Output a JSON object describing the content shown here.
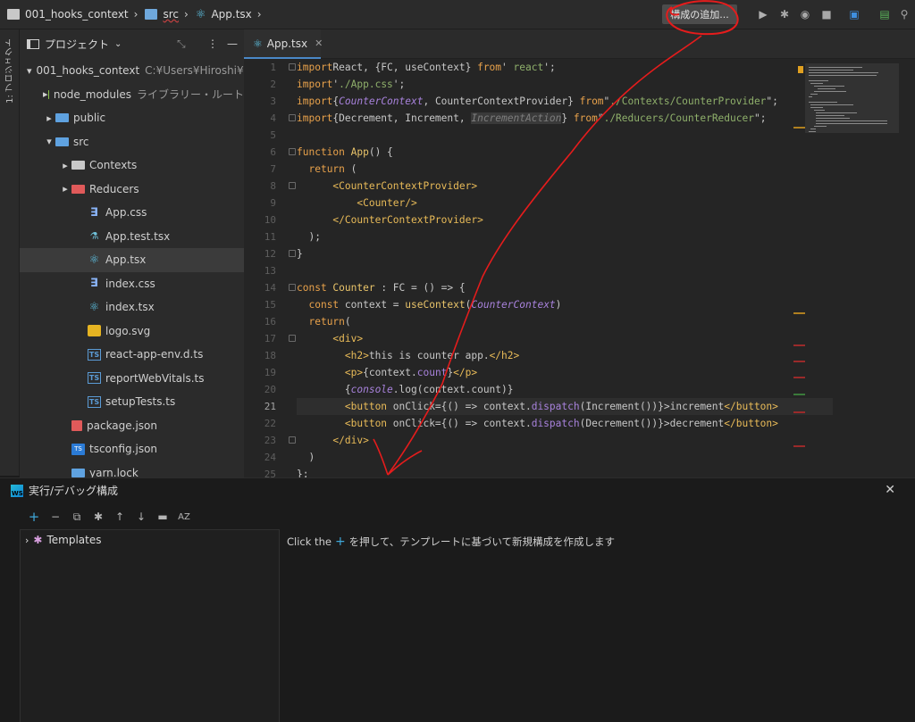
{
  "navbar": {
    "crumbs": [
      "001_hooks_context",
      "src",
      "App.tsx"
    ],
    "add_config_label": "構成の追加..."
  },
  "toolstrip": {
    "project_label": "1: プロジェクト"
  },
  "project": {
    "title": "プロジェクト",
    "tree": [
      {
        "label": "001_hooks_context",
        "hint": "C:¥Users¥Hiroshi¥Desk",
        "icon": "folder-icon",
        "arrow": "▾"
      },
      {
        "label": "node_modules",
        "hint": "ライブラリー・ルート",
        "icon": "folder-library-icon",
        "arrow": "▸"
      },
      {
        "label": "public",
        "hint": "",
        "icon": "folder-public-icon",
        "arrow": "▸"
      },
      {
        "label": "src",
        "hint": "",
        "icon": "folder-source-icon",
        "arrow": "▾"
      },
      {
        "label": "Contexts",
        "hint": "",
        "icon": "folder-icon",
        "arrow": "▸"
      },
      {
        "label": "Reducers",
        "hint": "",
        "icon": "folder-red-icon",
        "arrow": "▸"
      },
      {
        "label": "App.css",
        "hint": "",
        "icon": "css-file-icon",
        "arrow": ""
      },
      {
        "label": "App.test.tsx",
        "hint": "",
        "icon": "test-file-icon",
        "arrow": ""
      },
      {
        "label": "App.tsx",
        "hint": "",
        "icon": "react-file-icon",
        "arrow": ""
      },
      {
        "label": "index.css",
        "hint": "",
        "icon": "css-file-icon",
        "arrow": ""
      },
      {
        "label": "index.tsx",
        "hint": "",
        "icon": "react-file-icon",
        "arrow": ""
      },
      {
        "label": "logo.svg",
        "hint": "",
        "icon": "svg-file-icon",
        "arrow": ""
      },
      {
        "label": "react-app-env.d.ts",
        "hint": "",
        "icon": "ts-file-icon",
        "arrow": ""
      },
      {
        "label": "reportWebVitals.ts",
        "hint": "",
        "icon": "ts-file-icon",
        "arrow": ""
      },
      {
        "label": "setupTests.ts",
        "hint": "",
        "icon": "ts-file-icon",
        "arrow": ""
      },
      {
        "label": "package.json",
        "hint": "",
        "icon": "json-file-icon",
        "arrow": ""
      },
      {
        "label": "tsconfig.json",
        "hint": "",
        "icon": "tsconfig-file-icon",
        "arrow": ""
      },
      {
        "label": "yarn.lock",
        "hint": "",
        "icon": "yarn-file-icon",
        "arrow": ""
      }
    ]
  },
  "editor": {
    "tab_label": "App.tsx",
    "current_line": 21,
    "lines": [
      [
        [
          "kw",
          "import"
        ],
        [
          "",
          "React, {FC, useContext} "
        ],
        [
          "kw",
          "from"
        ],
        [
          "",
          "' "
        ],
        [
          "str",
          "react"
        ],
        [
          "",
          "';"
        ]
      ],
      [
        [
          "kw",
          "import"
        ],
        [
          "",
          "'"
        ],
        [
          "str",
          "./App.css"
        ],
        [
          "",
          "';"
        ]
      ],
      [
        [
          "kw",
          "import"
        ],
        [
          "",
          "{"
        ],
        [
          "ital",
          "CounterContext"
        ],
        [
          "",
          ", CounterContextProvider} "
        ],
        [
          "kw",
          "from"
        ],
        [
          "",
          "\""
        ],
        [
          "str",
          "./Contexts/CounterProvider"
        ],
        [
          "",
          "\";"
        ]
      ],
      [
        [
          "kw",
          "import"
        ],
        [
          "",
          "{Decrement, Increment, "
        ],
        [
          "dim",
          "IncrementAction"
        ],
        [
          "",
          "} "
        ],
        [
          "kw",
          "from"
        ],
        [
          "",
          "\""
        ],
        [
          "str",
          "./Reducers/CounterReducer"
        ],
        [
          "",
          "\";"
        ]
      ],
      [],
      [
        [
          "kw",
          "function"
        ],
        [
          "fn",
          " App"
        ],
        [
          "",
          "() {"
        ]
      ],
      [
        [
          "",
          "  "
        ],
        [
          "kw",
          "return"
        ],
        [
          "",
          " ("
        ]
      ],
      [
        [
          "",
          "      "
        ],
        [
          "tag",
          "<CounterContextProvider>"
        ]
      ],
      [
        [
          "",
          "          "
        ],
        [
          "tag",
          "<Counter/>"
        ]
      ],
      [
        [
          "",
          "      "
        ],
        [
          "tag",
          "</CounterContextProvider>"
        ]
      ],
      [
        [
          "",
          "  );"
        ]
      ],
      [
        [
          "",
          "}"
        ]
      ],
      [],
      [
        [
          "kw",
          "const"
        ],
        [
          "fn",
          " Counter"
        ],
        [
          "",
          " : FC = () => {"
        ]
      ],
      [
        [
          "",
          "  "
        ],
        [
          "kw",
          "const"
        ],
        [
          "",
          " context = "
        ],
        [
          "fn",
          "useContext"
        ],
        [
          "",
          "("
        ],
        [
          "ital",
          "CounterContext"
        ],
        [
          "",
          ")"
        ]
      ],
      [
        [
          "",
          "  "
        ],
        [
          "kw",
          "return"
        ],
        [
          "",
          "("
        ]
      ],
      [
        [
          "",
          "      "
        ],
        [
          "tag",
          "<div>"
        ]
      ],
      [
        [
          "",
          "        "
        ],
        [
          "tag",
          "<h2>"
        ],
        [
          "",
          "this is counter app."
        ],
        [
          "tag",
          "</h2>"
        ]
      ],
      [
        [
          "",
          "        "
        ],
        [
          "tag",
          "<p>"
        ],
        [
          "",
          "{context."
        ],
        [
          "pur",
          "count"
        ],
        [
          "",
          "}"
        ],
        [
          "tag",
          "</p>"
        ]
      ],
      [
        [
          "",
          "        {"
        ],
        [
          "ital",
          "console"
        ],
        [
          "",
          ".log(context.count)}"
        ]
      ],
      [
        [
          "",
          "        "
        ],
        [
          "tag",
          "<button"
        ],
        [
          "",
          " onClick={() => context."
        ],
        [
          "pur",
          "dispatch"
        ],
        [
          "",
          "(Increment())}>"
        ],
        [
          "",
          "increment"
        ],
        [
          "tag",
          "</button>"
        ]
      ],
      [
        [
          "",
          "        "
        ],
        [
          "tag",
          "<button"
        ],
        [
          "",
          " onClick={() => context."
        ],
        [
          "pur",
          "dispatch"
        ],
        [
          "",
          "(Decrement())}>"
        ],
        [
          "",
          "decrement"
        ],
        [
          "tag",
          "</button>"
        ]
      ],
      [
        [
          "",
          "      "
        ],
        [
          "tag",
          "</div>"
        ]
      ],
      [
        [
          "",
          "  )"
        ]
      ],
      [
        [
          "",
          "};"
        ]
      ]
    ]
  },
  "dialog": {
    "title": "実行/デバッグ構成",
    "templates_label": "Templates",
    "msg_before": "Click the",
    "msg_after": "を押して、テンプレートに基づいて新規構成を作成します"
  }
}
